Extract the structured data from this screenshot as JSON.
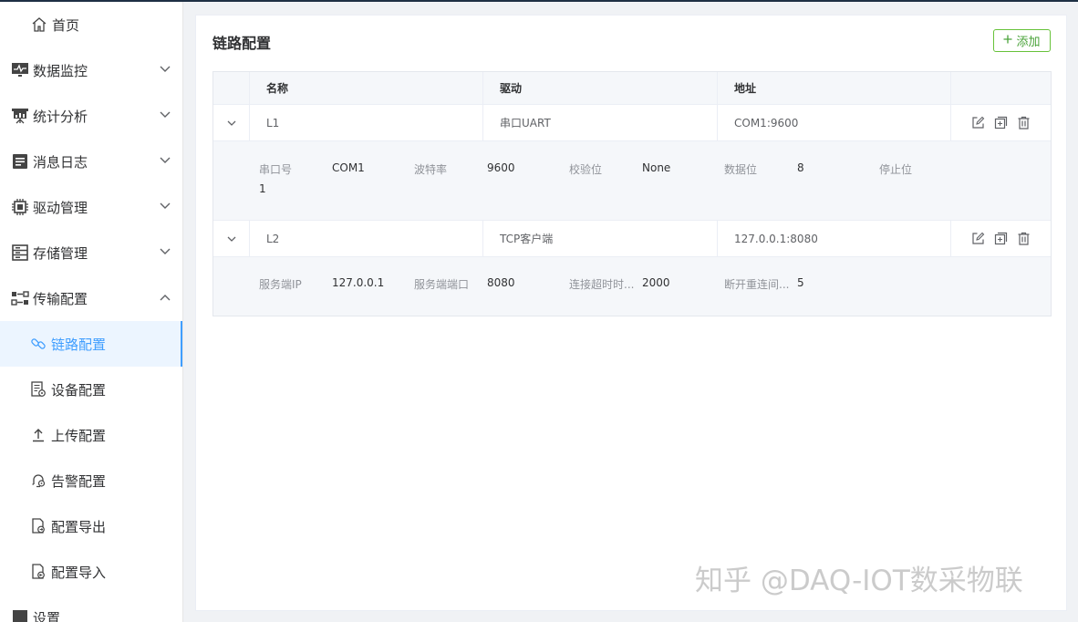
{
  "sidebar": {
    "home": "首页",
    "groups": [
      {
        "label": "数据监控"
      },
      {
        "label": "统计分析"
      },
      {
        "label": "消息日志"
      },
      {
        "label": "驱动管理"
      },
      {
        "label": "存储管理"
      },
      {
        "label": "传输配置"
      }
    ],
    "sub": [
      {
        "label": "链路配置"
      },
      {
        "label": "设备配置"
      },
      {
        "label": "上传配置"
      },
      {
        "label": "告警配置"
      },
      {
        "label": "配置导出"
      },
      {
        "label": "配置导入"
      }
    ],
    "next_partial": "设置"
  },
  "main": {
    "title": "链路配置",
    "add_button": "添加",
    "columns": [
      "名称",
      "驱动",
      "地址"
    ],
    "rows": [
      {
        "name": "L1",
        "driver": "串口UART",
        "address": "COM1:9600",
        "details": [
          {
            "label": "串口号",
            "value": "COM1"
          },
          {
            "label": "波特率",
            "value": "9600"
          },
          {
            "label": "校验位",
            "value": "None"
          },
          {
            "label": "数据位",
            "value": "8"
          },
          {
            "label": "停止位",
            "value": "1"
          }
        ]
      },
      {
        "name": "L2",
        "driver": "TCP客户端",
        "address": "127.0.0.1:8080",
        "details": [
          {
            "label": "服务端IP",
            "value": "127.0.0.1"
          },
          {
            "label": "服务端端口",
            "value": "8080"
          },
          {
            "label": "连接超时时...",
            "value": "2000"
          },
          {
            "label": "断开重连间...",
            "value": "5"
          }
        ]
      }
    ]
  },
  "watermark": "知乎 @DAQ-IOT数采物联",
  "colors": {
    "accent": "#409eff",
    "add_green": "#67c23a",
    "sidebar_bg": "#ffffff",
    "page_bg": "#f0f2f5"
  }
}
